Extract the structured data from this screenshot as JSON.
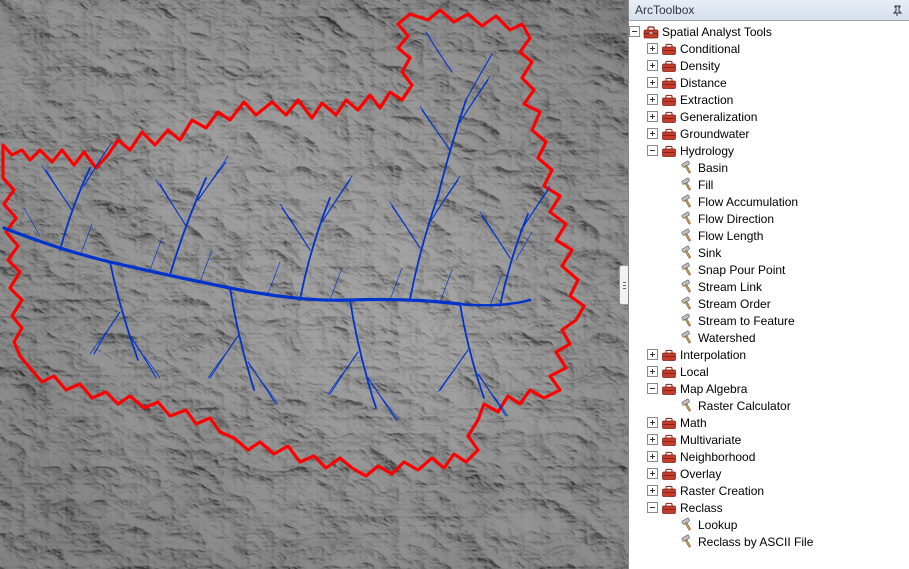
{
  "panel": {
    "title": "ArcToolbox"
  },
  "tree": {
    "root": {
      "label": "Spatial Analyst Tools",
      "expanded": true,
      "children": [
        {
          "label": "Conditional",
          "type": "toolset",
          "expanded": false
        },
        {
          "label": "Density",
          "type": "toolset",
          "expanded": false
        },
        {
          "label": "Distance",
          "type": "toolset",
          "expanded": false
        },
        {
          "label": "Extraction",
          "type": "toolset",
          "expanded": false
        },
        {
          "label": "Generalization",
          "type": "toolset",
          "expanded": false
        },
        {
          "label": "Groundwater",
          "type": "toolset",
          "expanded": false
        },
        {
          "label": "Hydrology",
          "type": "toolset",
          "expanded": true,
          "children": [
            {
              "label": "Basin",
              "type": "tool"
            },
            {
              "label": "Fill",
              "type": "tool"
            },
            {
              "label": "Flow Accumulation",
              "type": "tool"
            },
            {
              "label": "Flow Direction",
              "type": "tool"
            },
            {
              "label": "Flow Length",
              "type": "tool"
            },
            {
              "label": "Sink",
              "type": "tool"
            },
            {
              "label": "Snap Pour Point",
              "type": "tool"
            },
            {
              "label": "Stream Link",
              "type": "tool"
            },
            {
              "label": "Stream Order",
              "type": "tool"
            },
            {
              "label": "Stream to Feature",
              "type": "tool"
            },
            {
              "label": "Watershed",
              "type": "tool"
            }
          ]
        },
        {
          "label": "Interpolation",
          "type": "toolset",
          "expanded": false
        },
        {
          "label": "Local",
          "type": "toolset",
          "expanded": false
        },
        {
          "label": "Map Algebra",
          "type": "toolset",
          "expanded": true,
          "children": [
            {
              "label": "Raster Calculator",
              "type": "tool"
            }
          ]
        },
        {
          "label": "Math",
          "type": "toolset",
          "expanded": false
        },
        {
          "label": "Multivariate",
          "type": "toolset",
          "expanded": false
        },
        {
          "label": "Neighborhood",
          "type": "toolset",
          "expanded": false
        },
        {
          "label": "Overlay",
          "type": "toolset",
          "expanded": false
        },
        {
          "label": "Raster Creation",
          "type": "toolset",
          "expanded": false
        },
        {
          "label": "Reclass",
          "type": "toolset",
          "expanded": true,
          "children": [
            {
              "label": "Lookup",
              "type": "tool"
            },
            {
              "label": "Reclass by ASCII File",
              "type": "tool"
            }
          ]
        }
      ]
    }
  },
  "colors": {
    "watershed_outline": "#ff0000",
    "streams": "#0033cc"
  }
}
